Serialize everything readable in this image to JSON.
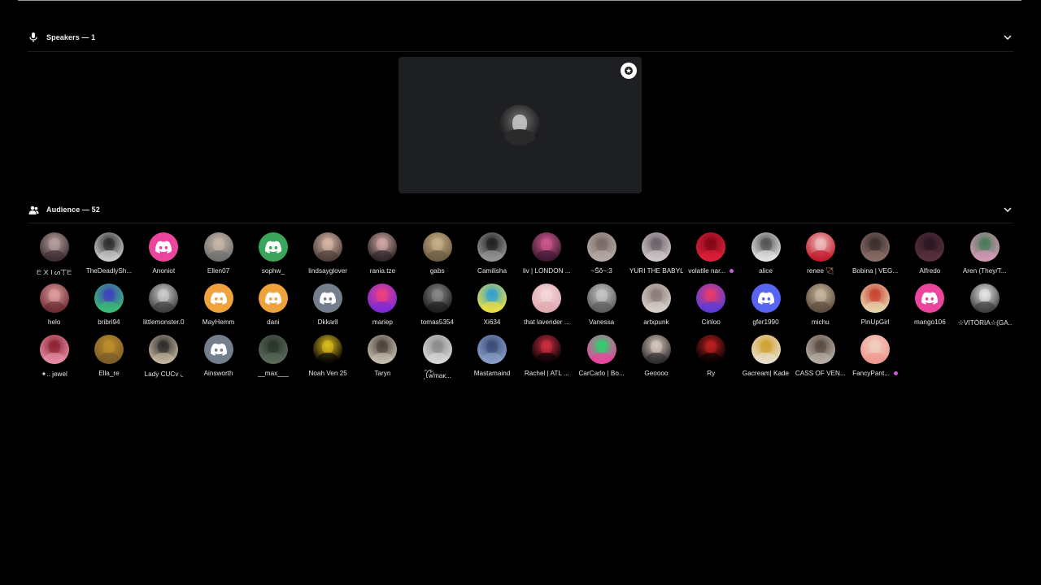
{
  "speakers": {
    "title": "Speakers — 1",
    "icon": "microphone-icon"
  },
  "speaker": {
    "icon": "moderator-badge-icon"
  },
  "audience": {
    "title": "Audience — 52",
    "icon": "audience-icon",
    "members": [
      {
        "name": "ᗴ ᙭ I ᔕ丅ᗴ",
        "type": "photo",
        "c1": "#3a2a2e",
        "c2": "#b8a3a0"
      },
      {
        "name": "TheDeadlySh...",
        "type": "photo",
        "c1": "#cfcfcf",
        "c2": "#2a2a2a"
      },
      {
        "name": "Anoniot",
        "type": "discord",
        "bg": "#eb459e"
      },
      {
        "name": "Ellen07",
        "type": "photo",
        "c1": "#6e6e6e",
        "c2": "#c9b9a8"
      },
      {
        "name": "sophw_",
        "type": "discord",
        "bg": "#3ba55c"
      },
      {
        "name": "lindsayglover",
        "type": "photo",
        "c1": "#4a3a36",
        "c2": "#d8b8a8"
      },
      {
        "name": "rania.tze",
        "type": "photo",
        "c1": "#2a2225",
        "c2": "#d4a9a6"
      },
      {
        "name": "gabs",
        "type": "photo",
        "c1": "#6b5a40",
        "c2": "#c8b088"
      },
      {
        "name": "Camilisha",
        "type": "photo",
        "c1": "#9a9a9a",
        "c2": "#1e1e1e"
      },
      {
        "name": "liv | LONDON ...",
        "type": "photo",
        "c1": "#3a1830",
        "c2": "#d05a90"
      },
      {
        "name": "~Ŝŏ~:3",
        "type": "photo",
        "c1": "#b8aca8",
        "c2": "#7a6a66"
      },
      {
        "name": "YURI THE BABYL...",
        "type": "photo",
        "c1": "#d0c8cc",
        "c2": "#6a6066"
      },
      {
        "name": "volatile nar...",
        "type": "photo",
        "c1": "#e0203a",
        "c2": "#800818",
        "nitro": true
      },
      {
        "name": "alice",
        "type": "photo",
        "c1": "#e8e8e8",
        "c2": "#505050"
      },
      {
        "name": "renee 🏹",
        "type": "photo",
        "c1": "#c01828",
        "c2": "#f0c0c0"
      },
      {
        "name": "Bobina | VEG...",
        "type": "photo",
        "c1": "#8a6e68",
        "c2": "#3a2e2c"
      },
      {
        "name": "Alfredo",
        "type": "photo",
        "c1": "#5a3040",
        "c2": "#2a1820"
      },
      {
        "name": "Aren (They/T...",
        "type": "photo",
        "c1": "#d89ab8",
        "c2": "#4a7a58"
      },
      {
        "name": "helo",
        "type": "photo",
        "c1": "#6a2a30",
        "c2": "#e0a0a0"
      },
      {
        "name": "bribri94",
        "type": "photo",
        "c1": "#3ac070",
        "c2": "#4040c0"
      },
      {
        "name": "littlemonster.0",
        "type": "photo",
        "c1": "#3a3a3a",
        "c2": "#d0d0d0"
      },
      {
        "name": "MayHemm",
        "type": "discord",
        "bg": "#f0a23c"
      },
      {
        "name": "dani",
        "type": "discord",
        "bg": "#f0a23c"
      },
      {
        "name": "Dkkarll",
        "type": "discord",
        "bg": "#747f8d"
      },
      {
        "name": "mariep",
        "type": "photo",
        "c1": "#7a2ad8",
        "c2": "#f04080"
      },
      {
        "name": "tomas5354",
        "type": "photo",
        "c1": "#1a1a1a",
        "c2": "#8a8a8a"
      },
      {
        "name": "Xi634",
        "type": "photo",
        "c1": "#f0e040",
        "c2": "#30a0d0"
      },
      {
        "name": "that lavender ...",
        "type": "photo",
        "c1": "#e0a8b0",
        "c2": "#f4d8d8"
      },
      {
        "name": "Vanessa",
        "type": "photo",
        "c1": "#5a5a5a",
        "c2": "#c8c8c8"
      },
      {
        "name": "artxpunk",
        "type": "photo",
        "c1": "#d8d0cc",
        "c2": "#8a7a78"
      },
      {
        "name": "Cinloo",
        "type": "photo",
        "c1": "#5a3ad8",
        "c2": "#e83a6a"
      },
      {
        "name": "gfer1990",
        "type": "discord",
        "bg": "#5865f2"
      },
      {
        "name": "michu",
        "type": "photo",
        "c1": "#5a4a3a",
        "c2": "#c8b8a0"
      },
      {
        "name": "PinUpGirl",
        "type": "photo",
        "c1": "#e8d8b0",
        "c2": "#c84030"
      },
      {
        "name": "mango106",
        "type": "discord",
        "bg": "#eb459e"
      },
      {
        "name": "☆VITÓRIA☆(GA...",
        "type": "photo",
        "c1": "#3a3a3a",
        "c2": "#e8e8e8"
      },
      {
        "name": "✦.. jewel",
        "type": "photo",
        "c1": "#e890a8",
        "c2": "#8a2030"
      },
      {
        "name": "Ella_re",
        "type": "photo",
        "c1": "#7a5a28",
        "c2": "#c0902a"
      },
      {
        "name": "Lady CUCv ◟",
        "type": "photo",
        "c1": "#c8b8a0",
        "c2": "#2a2a2a"
      },
      {
        "name": "Ainsworth",
        "type": "discord",
        "bg": "#747f8d"
      },
      {
        "name": "__max___",
        "type": "photo",
        "c1": "#5a6a5a",
        "c2": "#2a342a"
      },
      {
        "name": "Noah Ven 25",
        "type": "photo",
        "c1": "#000000",
        "c2": "#e0c020"
      },
      {
        "name": "Taryn",
        "type": "photo",
        "c1": "#c8c0b0",
        "c2": "#4a4038"
      },
      {
        "name": "˛ꪶ꫁ꪝ꫁maк...",
        "type": "photo",
        "c1": "#d8d8d8",
        "c2": "#8a8a8a"
      },
      {
        "name": "Mastamaind",
        "type": "photo",
        "c1": "#8aa0c8",
        "c2": "#3a4a78"
      },
      {
        "name": "Rachel | ATL ...",
        "type": "photo",
        "c1": "#000000",
        "c2": "#d03040"
      },
      {
        "name": "CarCarlo | Bo...",
        "type": "photo",
        "c1": "#f040a0",
        "c2": "#30d070"
      },
      {
        "name": "Geoooo",
        "type": "photo",
        "c1": "#2a2a2a",
        "c2": "#d8c8c0"
      },
      {
        "name": "Ry",
        "type": "photo",
        "c1": "#000000",
        "c2": "#c02020"
      },
      {
        "name": "Gacream| Kade",
        "type": "photo",
        "c1": "#e8e0d0",
        "c2": "#d0a030"
      },
      {
        "name": "CASS OF VEN...",
        "type": "photo",
        "c1": "#b8b0a8",
        "c2": "#5a4a40"
      },
      {
        "name": "FancyPant...",
        "type": "photo",
        "c1": "#f09890",
        "c2": "#f0d0c0",
        "nitro": true
      }
    ]
  },
  "colors": {
    "background": "#000000",
    "stage_tile": "#1e1f22",
    "text": "#f2f3f5",
    "divider": "#1d1e21",
    "nitro": "#c55bd6"
  }
}
